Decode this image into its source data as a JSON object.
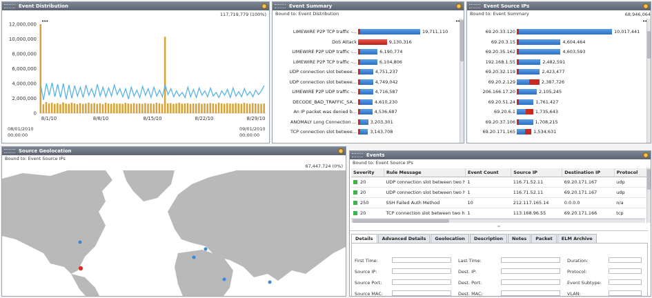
{
  "event_distribution": {
    "title": "Event Distribution",
    "total": "117,719,779 (100%)",
    "y_labels": [
      "12,000,000",
      "10,000,000",
      "8,000,000",
      "6,000,000",
      "4,000,000",
      "2,000,000",
      "0"
    ],
    "x_labels": [
      {
        "l1": "8/1/10",
        "l2": ""
      },
      {
        "l1": "8/8/10",
        "l2": ""
      },
      {
        "l1": "8/15/10",
        "l2": ""
      },
      {
        "l1": "8/22/10",
        "l2": ""
      },
      {
        "l1": "8/29/10",
        "l2": ""
      }
    ],
    "range_start_date": "08/01/2010",
    "range_start_time": "00:00:00",
    "range_end_date": "09/01/2010",
    "range_end_time": "00:00:00",
    "colors": {
      "bars": "#d9a236",
      "line": "#58b4e6"
    },
    "chart_data": {
      "type": "bar",
      "series": [
        {
          "values": [
            12000000,
            1200000,
            1500000,
            1300000,
            1400000,
            1250000,
            1350000,
            1200000,
            1450000,
            1300000,
            1250000,
            1400000,
            1300000,
            1200000,
            1350000,
            1250000,
            1300000,
            1400000,
            1280000,
            1350000,
            1250000,
            1320000,
            1200000,
            1400000,
            1300000,
            1250000,
            1350000,
            1280000,
            1300000,
            1250000,
            1380000,
            1300000,
            1250000,
            1350000,
            1270000,
            1300000,
            1250000,
            1350000,
            1280000,
            1300000,
            1250000,
            1400000,
            1320000,
            1250000,
            10300000,
            1300000,
            1350000,
            1250000,
            1300000,
            1400000,
            1280000,
            1300000,
            1350000,
            1250000,
            1300000,
            1280000,
            1350000,
            1250000,
            1300000,
            1270000,
            1350000,
            1300000,
            1250000,
            1400000,
            1300000,
            1250000,
            1350000,
            1300000,
            1280000,
            1350000,
            1300000,
            1250000,
            1400000,
            1300000,
            1250000,
            1350000,
            1300000,
            1280000,
            1250000,
            1300000
          ]
        },
        {
          "values": [
            3800000,
            1800000,
            4000000,
            2400000,
            4100000,
            2200000,
            3900000,
            2100000,
            4000000,
            1900000,
            3800000,
            2000000,
            3700000,
            2300000,
            3500000,
            2100000,
            3800000,
            2400000,
            3300000,
            2200000,
            3900000,
            2300000,
            3500000,
            2200000,
            3400000,
            2300000,
            3800000,
            2500000,
            3300000,
            2200000,
            3300000,
            1900000,
            3500000,
            2300000,
            3100000,
            2100000,
            3600000,
            2400000,
            3300000,
            2100000,
            3500000,
            2300000,
            3100000,
            2200000,
            3800000,
            2500000,
            3300000,
            2200000,
            3000000,
            2300000,
            2800000,
            2100000,
            3500000,
            2200000,
            3200000,
            2100000,
            3400000,
            2400000,
            3000000,
            2200000,
            3400000,
            2300000,
            2800000,
            2100000,
            3000000,
            2400000,
            3200000,
            2100000,
            3400000,
            2300000,
            2900000,
            2200000,
            3300000,
            2400000,
            2900000,
            2200000,
            3100000,
            2500000,
            3000000,
            3700000
          ]
        }
      ],
      "ylim": [
        0,
        12000000
      ]
    }
  },
  "event_summary": {
    "title": "Event Summary",
    "bound": "Bound to: Event Distribution",
    "chart_data": {
      "type": "bar",
      "categories": [
        "LIMEWIRE P2P TCP traffic -...",
        "DoS Attack",
        "LIMEWIRE P2P UDP traffic -...",
        "LIMEWIRE P2P TCP traffic -...",
        "UDP connection slot betwee...",
        "UDP connection slot betwee...",
        "LIMEWIRE P2P UDP traffic -...",
        "DECODE_BAD_TRAFFIC_SA...",
        "An IP packet was denied b...",
        "ANOMALY Long Connection ...",
        "TCP connection slot betwee..."
      ],
      "values": [
        19711110,
        9130316,
        6190774,
        6104806,
        4751237,
        4749042,
        4716587,
        4610230,
        4536687,
        3203301,
        3143708
      ],
      "value_labels": [
        "19,711,110",
        "9,130,316",
        "6,190,774",
        "6,104,806",
        "4,751,237",
        "4,749,042",
        "4,716,587",
        "4,610,230",
        "4,536,687",
        "3,203,301",
        "3,143,708"
      ],
      "red_rows": [
        1
      ]
    }
  },
  "event_source_ips": {
    "title": "Event Source IPs",
    "bound": "Bound to: Event Summary",
    "total": "68,946,064",
    "chart_data": {
      "type": "bar",
      "categories": [
        "69.20.33.120",
        "69.20.3.15",
        "69.20.35.162",
        "192.168.1.55",
        "69.20.32.119",
        "69.20.2.129",
        "206.166.17.20",
        "69.20.51.24",
        "69.20.6.1",
        "69.20.37.106",
        "69.20.171.165"
      ],
      "values": [
        10017441,
        4604464,
        4603593,
        2482591,
        2423477,
        2387726,
        2105245,
        1761427,
        1735643,
        1708215,
        1534631
      ],
      "value_labels": [
        "10,017,441",
        "4,604,464",
        "4,603,593",
        "2,482,591",
        "2,423,477",
        "2,387,726",
        "2,105,245",
        "1,761,427",
        "1,735,643",
        "1,708,215",
        "1,534,631"
      ],
      "red_rows": [
        5,
        8,
        10
      ]
    }
  },
  "source_geolocation": {
    "title": "Source Geolocation",
    "bound": "Bound to: Event Source IPs",
    "total": "67,447,724 (0%)",
    "colors": {
      "water": "#ffffff",
      "land": "#b9b9b9",
      "dot_blue": "#3d86d8",
      "dot_red": "#d9342b"
    }
  },
  "events": {
    "title": "Events",
    "bound": "Bound to: Event Source IPs",
    "columns": [
      "Severity",
      "Rule Message",
      "Event Count",
      "Source IP",
      "Destination IP",
      "Protocol"
    ],
    "rows": [
      [
        "20",
        "UDP connection slot between two h",
        "1",
        "116.71.52.11",
        "69.20.171.167",
        "udp"
      ],
      [
        "20",
        "UDP connection slot between two h",
        "1",
        "116.71.52.11",
        "69.20.171.167",
        "udp"
      ],
      [
        "250",
        "SSH Failed Auth Method",
        "10",
        "212.117.165.14",
        "0.0.0.0",
        "n/a"
      ],
      [
        "20",
        "TCP connection slot between two h",
        "1",
        "113.168.96.55",
        "69.20.171.166",
        "tcp"
      ]
    ],
    "tabs": [
      "Details",
      "Advanced Details",
      "Geolocation",
      "Description",
      "Notes",
      "Packet",
      "ELM Archive"
    ],
    "detail_labels": {
      "col1": [
        "First Time:",
        "Source IP:",
        "Source Port:",
        "Source MAC:"
      ],
      "col2": [
        "Last Time:",
        "Dest. IP:",
        "Dest. Port:",
        "Dest. MAC:"
      ],
      "col3": [
        "Duration:",
        "Protocol:",
        "Event Subtype:",
        "VLAN:"
      ]
    }
  }
}
